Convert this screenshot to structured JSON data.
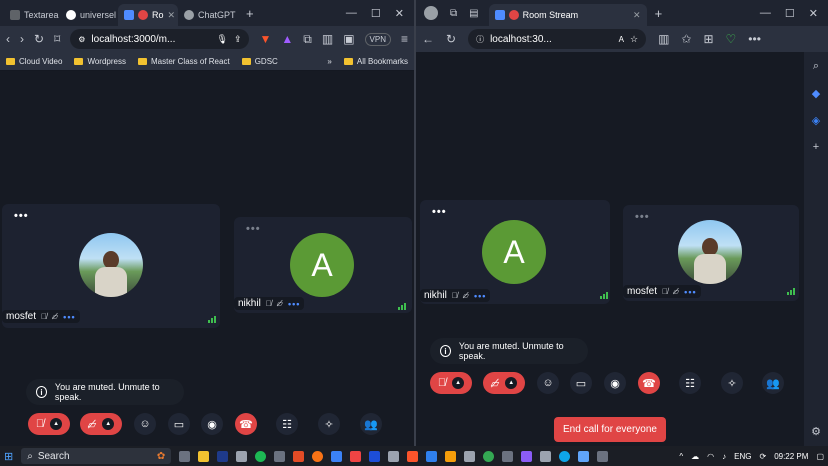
{
  "left_browser": {
    "tabs": [
      {
        "label": "Textarea",
        "color": "#9aa0a6"
      },
      {
        "label": "universel",
        "color": "#ffffff"
      },
      {
        "label": "Ro",
        "color": "#e04545"
      },
      {
        "label": "ChatGPT",
        "color": "#9aa0a6"
      }
    ],
    "url": "localhost:3000/m...",
    "vpn_label": "VPN",
    "bookmarks": [
      "Cloud Video",
      "Wordpress",
      "Master Class of React",
      "GDSC"
    ],
    "all_bookmarks": "All Bookmarks",
    "participants": [
      {
        "name": "mosfet",
        "avatar": "photo"
      },
      {
        "name": "nikhil",
        "avatar": "letter",
        "letter": "A"
      }
    ],
    "toast": "You are muted. Unmute to speak."
  },
  "right_browser": {
    "tab_title": "Room Stream",
    "url": "localhost:30...",
    "participants": [
      {
        "name": "nikhil",
        "avatar": "letter",
        "letter": "A"
      },
      {
        "name": "mosfet",
        "avatar": "photo"
      }
    ],
    "toast": "You are muted. Unmute to speak.",
    "end_call_label": "End call for everyone"
  },
  "taskbar": {
    "search_label": "Search",
    "language": "ENG",
    "time": "09:22 PM"
  },
  "colors": {
    "accent_red": "#e04545",
    "avatar_green": "#5b9a35",
    "signal_green": "#3fbf4f",
    "link_blue": "#4f8cff"
  }
}
